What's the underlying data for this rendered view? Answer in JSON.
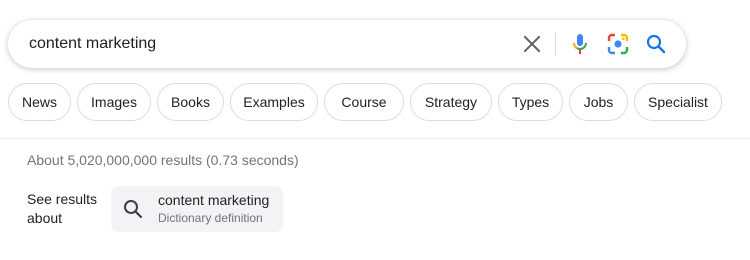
{
  "search": {
    "query": "content marketing"
  },
  "chips": [
    {
      "label": "News"
    },
    {
      "label": "Images"
    },
    {
      "label": "Books"
    },
    {
      "label": "Examples"
    },
    {
      "label": "Course"
    },
    {
      "label": "Strategy"
    },
    {
      "label": "Types"
    },
    {
      "label": "Jobs"
    },
    {
      "label": "Specialist"
    }
  ],
  "results": {
    "stats": "About 5,020,000,000 results (0.73 seconds)"
  },
  "see_results": {
    "label": "See results about",
    "card_title": "content marketing",
    "card_subtitle": "Dictionary definition"
  },
  "icons": {
    "clear": "close-icon",
    "mic": "microphone-icon",
    "lens": "google-lens-icon",
    "search": "search-icon",
    "dict": "search-icon"
  },
  "colors": {
    "blue": "#4285f4",
    "red": "#ea4335",
    "yellow": "#fbbc04",
    "green": "#34a853",
    "search_blue": "#1a73e8"
  }
}
